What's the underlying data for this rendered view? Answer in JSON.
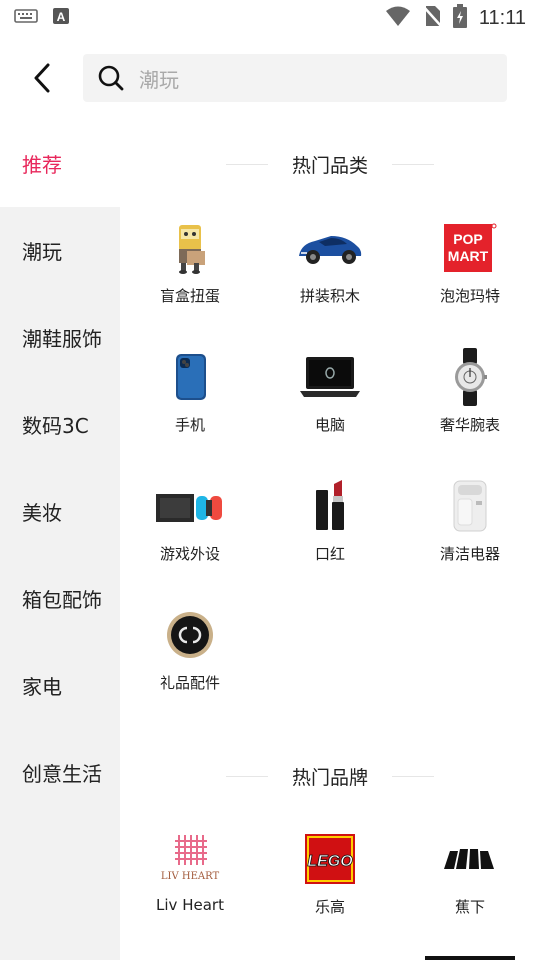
{
  "status_bar": {
    "time": "11:11"
  },
  "search": {
    "query": "潮玩"
  },
  "sidebar": {
    "items": [
      {
        "label": "推荐"
      },
      {
        "label": "潮玩"
      },
      {
        "label": "潮鞋服饰"
      },
      {
        "label": "数码3C"
      },
      {
        "label": "美妆"
      },
      {
        "label": "箱包配饰"
      },
      {
        "label": "家电"
      },
      {
        "label": "创意生活"
      }
    ]
  },
  "hot_categories": {
    "title": "热门品类",
    "items": [
      {
        "label": "盲盒扭蛋",
        "icon": "blind-box-icon"
      },
      {
        "label": "拼装积木",
        "icon": "building-blocks-car-icon"
      },
      {
        "label": "泡泡玛特",
        "icon": "pop-mart-logo",
        "logo_text": [
          "POP",
          "MART"
        ]
      },
      {
        "label": "手机",
        "icon": "phone-icon"
      },
      {
        "label": "电脑",
        "icon": "laptop-icon"
      },
      {
        "label": "奢华腕表",
        "icon": "watch-icon"
      },
      {
        "label": "游戏外设",
        "icon": "game-console-icon"
      },
      {
        "label": "口红",
        "icon": "lipstick-icon"
      },
      {
        "label": "清洁电器",
        "icon": "cleaning-appliance-icon"
      },
      {
        "label": "礼品配件",
        "icon": "gift-accessory-icon"
      }
    ]
  },
  "hot_brands": {
    "title": "热门品牌",
    "items": [
      {
        "label": "Liv Heart",
        "icon": "liv-heart-logo",
        "logo_text": "LIV HEART"
      },
      {
        "label": "乐高",
        "icon": "lego-logo",
        "logo_text": "LEGO"
      },
      {
        "label": "蕉下",
        "icon": "bananain-logo"
      }
    ]
  },
  "colors": {
    "accent": "#e8275b",
    "sidebar_bg": "#f2f2f2"
  }
}
